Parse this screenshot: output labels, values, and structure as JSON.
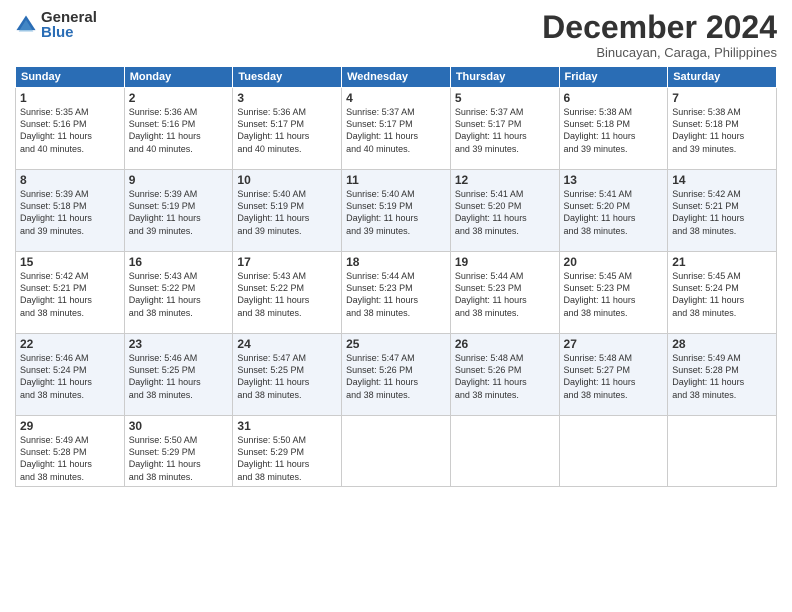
{
  "logo": {
    "general": "General",
    "blue": "Blue"
  },
  "title": "December 2024",
  "subtitle": "Binucayan, Caraga, Philippines",
  "days_header": [
    "Sunday",
    "Monday",
    "Tuesday",
    "Wednesday",
    "Thursday",
    "Friday",
    "Saturday"
  ],
  "weeks": [
    [
      {
        "day": "1",
        "info": "Sunrise: 5:35 AM\nSunset: 5:16 PM\nDaylight: 11 hours\nand 40 minutes."
      },
      {
        "day": "2",
        "info": "Sunrise: 5:36 AM\nSunset: 5:16 PM\nDaylight: 11 hours\nand 40 minutes."
      },
      {
        "day": "3",
        "info": "Sunrise: 5:36 AM\nSunset: 5:17 PM\nDaylight: 11 hours\nand 40 minutes."
      },
      {
        "day": "4",
        "info": "Sunrise: 5:37 AM\nSunset: 5:17 PM\nDaylight: 11 hours\nand 40 minutes."
      },
      {
        "day": "5",
        "info": "Sunrise: 5:37 AM\nSunset: 5:17 PM\nDaylight: 11 hours\nand 39 minutes."
      },
      {
        "day": "6",
        "info": "Sunrise: 5:38 AM\nSunset: 5:18 PM\nDaylight: 11 hours\nand 39 minutes."
      },
      {
        "day": "7",
        "info": "Sunrise: 5:38 AM\nSunset: 5:18 PM\nDaylight: 11 hours\nand 39 minutes."
      }
    ],
    [
      {
        "day": "8",
        "info": "Sunrise: 5:39 AM\nSunset: 5:18 PM\nDaylight: 11 hours\nand 39 minutes."
      },
      {
        "day": "9",
        "info": "Sunrise: 5:39 AM\nSunset: 5:19 PM\nDaylight: 11 hours\nand 39 minutes."
      },
      {
        "day": "10",
        "info": "Sunrise: 5:40 AM\nSunset: 5:19 PM\nDaylight: 11 hours\nand 39 minutes."
      },
      {
        "day": "11",
        "info": "Sunrise: 5:40 AM\nSunset: 5:19 PM\nDaylight: 11 hours\nand 39 minutes."
      },
      {
        "day": "12",
        "info": "Sunrise: 5:41 AM\nSunset: 5:20 PM\nDaylight: 11 hours\nand 38 minutes."
      },
      {
        "day": "13",
        "info": "Sunrise: 5:41 AM\nSunset: 5:20 PM\nDaylight: 11 hours\nand 38 minutes."
      },
      {
        "day": "14",
        "info": "Sunrise: 5:42 AM\nSunset: 5:21 PM\nDaylight: 11 hours\nand 38 minutes."
      }
    ],
    [
      {
        "day": "15",
        "info": "Sunrise: 5:42 AM\nSunset: 5:21 PM\nDaylight: 11 hours\nand 38 minutes."
      },
      {
        "day": "16",
        "info": "Sunrise: 5:43 AM\nSunset: 5:22 PM\nDaylight: 11 hours\nand 38 minutes."
      },
      {
        "day": "17",
        "info": "Sunrise: 5:43 AM\nSunset: 5:22 PM\nDaylight: 11 hours\nand 38 minutes."
      },
      {
        "day": "18",
        "info": "Sunrise: 5:44 AM\nSunset: 5:23 PM\nDaylight: 11 hours\nand 38 minutes."
      },
      {
        "day": "19",
        "info": "Sunrise: 5:44 AM\nSunset: 5:23 PM\nDaylight: 11 hours\nand 38 minutes."
      },
      {
        "day": "20",
        "info": "Sunrise: 5:45 AM\nSunset: 5:23 PM\nDaylight: 11 hours\nand 38 minutes."
      },
      {
        "day": "21",
        "info": "Sunrise: 5:45 AM\nSunset: 5:24 PM\nDaylight: 11 hours\nand 38 minutes."
      }
    ],
    [
      {
        "day": "22",
        "info": "Sunrise: 5:46 AM\nSunset: 5:24 PM\nDaylight: 11 hours\nand 38 minutes."
      },
      {
        "day": "23",
        "info": "Sunrise: 5:46 AM\nSunset: 5:25 PM\nDaylight: 11 hours\nand 38 minutes."
      },
      {
        "day": "24",
        "info": "Sunrise: 5:47 AM\nSunset: 5:25 PM\nDaylight: 11 hours\nand 38 minutes."
      },
      {
        "day": "25",
        "info": "Sunrise: 5:47 AM\nSunset: 5:26 PM\nDaylight: 11 hours\nand 38 minutes."
      },
      {
        "day": "26",
        "info": "Sunrise: 5:48 AM\nSunset: 5:26 PM\nDaylight: 11 hours\nand 38 minutes."
      },
      {
        "day": "27",
        "info": "Sunrise: 5:48 AM\nSunset: 5:27 PM\nDaylight: 11 hours\nand 38 minutes."
      },
      {
        "day": "28",
        "info": "Sunrise: 5:49 AM\nSunset: 5:28 PM\nDaylight: 11 hours\nand 38 minutes."
      }
    ],
    [
      {
        "day": "29",
        "info": "Sunrise: 5:49 AM\nSunset: 5:28 PM\nDaylight: 11 hours\nand 38 minutes."
      },
      {
        "day": "30",
        "info": "Sunrise: 5:50 AM\nSunset: 5:29 PM\nDaylight: 11 hours\nand 38 minutes."
      },
      {
        "day": "31",
        "info": "Sunrise: 5:50 AM\nSunset: 5:29 PM\nDaylight: 11 hours\nand 38 minutes."
      },
      {
        "day": "",
        "info": ""
      },
      {
        "day": "",
        "info": ""
      },
      {
        "day": "",
        "info": ""
      },
      {
        "day": "",
        "info": ""
      }
    ]
  ]
}
